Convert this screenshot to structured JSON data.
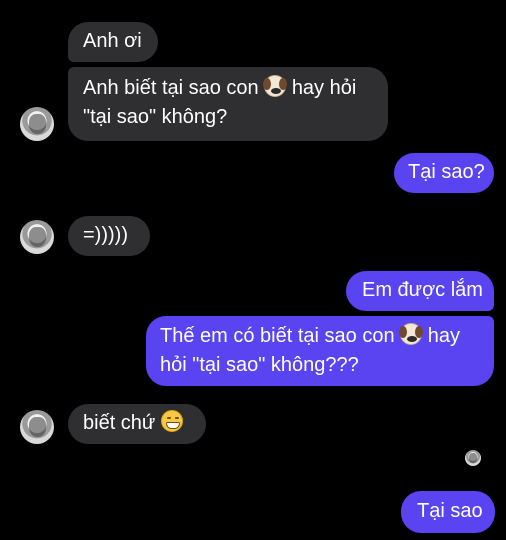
{
  "thread": {
    "messages": [
      {
        "id": "m1",
        "direction": "incoming",
        "text": "Anh ơi"
      },
      {
        "id": "m2",
        "direction": "incoming",
        "line1_before_emoji": "Anh biết tại sao con",
        "emoji": "dog-face",
        "line1_after_emoji": "hay hỏi",
        "line2": "\"tại sao\" không?"
      },
      {
        "id": "m3",
        "direction": "outgoing",
        "text": "Tại sao?"
      },
      {
        "id": "m4",
        "direction": "incoming",
        "text": "=)))))"
      },
      {
        "id": "m5",
        "direction": "outgoing",
        "text": "Em được lắm"
      },
      {
        "id": "m6",
        "direction": "outgoing",
        "line1_before_emoji": "Thế em có biết tại sao con",
        "emoji": "dog-face",
        "line1_after_emoji": "hay",
        "line2": "hỏi \"tại sao\" không???"
      },
      {
        "id": "m7",
        "direction": "incoming",
        "text_before_emoji": "biết chứ",
        "emoji": "grinning-face"
      },
      {
        "id": "m8",
        "direction": "outgoing",
        "text": "Tại sao"
      }
    ]
  },
  "colors": {
    "background": "#000000",
    "incoming_bubble": "#2f2f31",
    "outgoing_bubble": "#5a43f0",
    "text": "#ffffff"
  }
}
